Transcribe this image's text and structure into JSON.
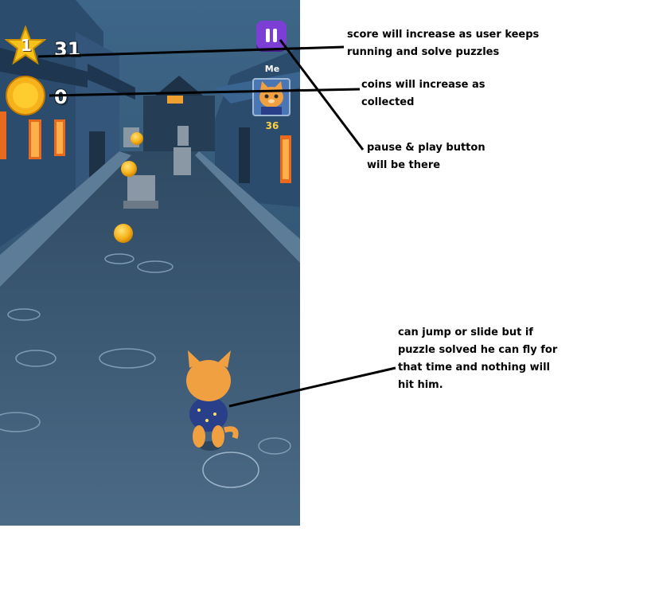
{
  "hud": {
    "level": "1",
    "score": "31",
    "coins": "0",
    "me_label": "Me",
    "me_score": "36"
  },
  "icons": {
    "level": "star-icon",
    "coins": "coin-icon",
    "pause": "pause-icon",
    "avatar": "cat-avatar"
  },
  "colors": {
    "pause_button": "#7b3fd6",
    "coin": "#f6b21a",
    "star": "#f7c21b"
  },
  "annotations": {
    "score": [
      "score will increase as user keeps",
      "running and solve puzzles"
    ],
    "coins": [
      "coins will increase as",
      "collected"
    ],
    "pause": [
      "pause & play button",
      "will be there"
    ],
    "player": [
      "can jump or slide but if",
      "puzzle solved he can fly for",
      "that time and nothing will",
      "hit him."
    ]
  }
}
